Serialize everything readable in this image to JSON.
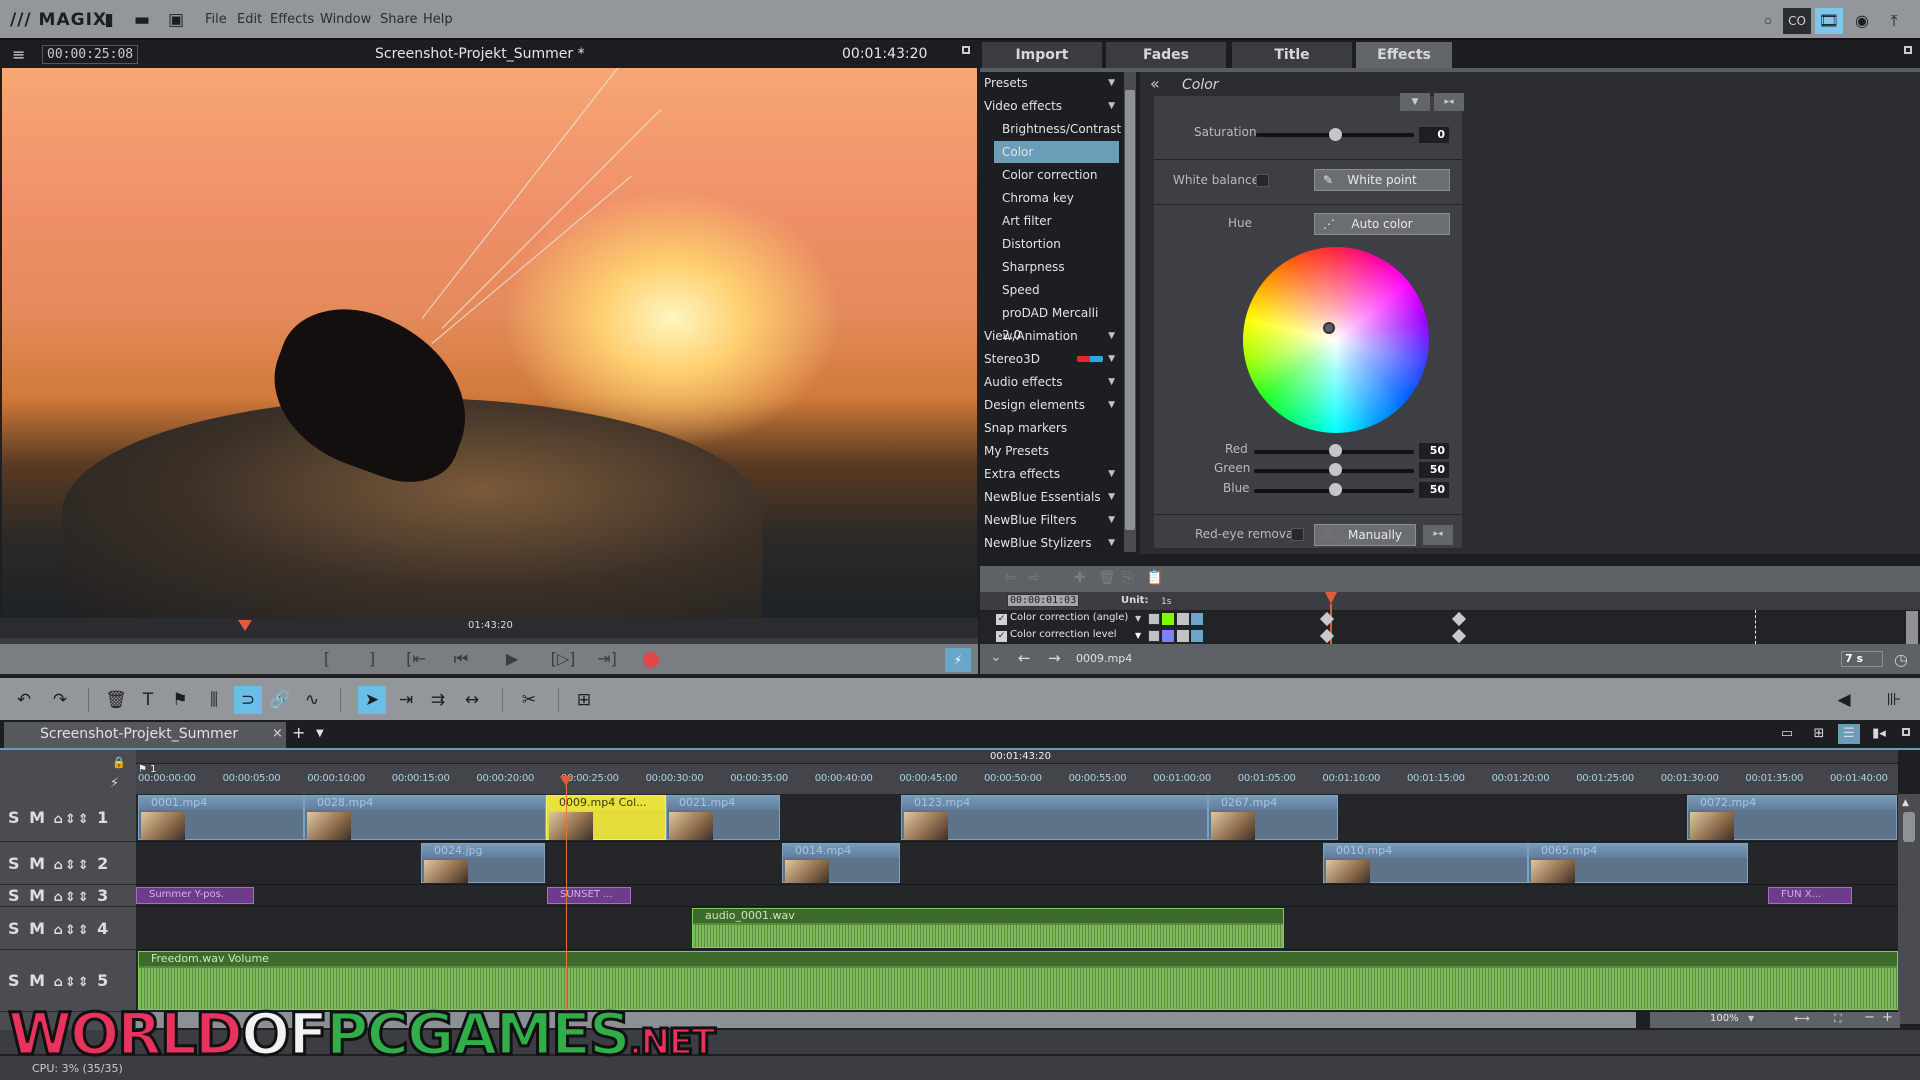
{
  "app": {
    "logo": "/// MAGIX",
    "menu": [
      "File",
      "Edit",
      "Effects",
      "Window",
      "Share",
      "Help"
    ],
    "file_icons": [
      "new-file-icon",
      "open-folder-icon",
      "save-icon"
    ],
    "right_icons": [
      "dot-icon",
      "cloud-icon",
      "movie-edit-icon",
      "disc-icon",
      "upload-icon"
    ]
  },
  "preview": {
    "timecode_current": "00:00:25:08",
    "project_title": "Screenshot-Projekt_Summer *",
    "timecode_total": "00:01:43:20",
    "scrub_time": "01:43:20",
    "transport": [
      "[",
      "]",
      "[⇤",
      "⏮",
      "▶",
      "[▷]",
      "⇥]"
    ]
  },
  "panel": {
    "tabs": [
      "Import",
      "Fades",
      "Title",
      "Effects"
    ],
    "active_tab": "Effects",
    "effects_list": [
      {
        "label": "Presets",
        "sub": false,
        "arrow": true
      },
      {
        "label": "Video effects",
        "sub": false,
        "arrow": true
      },
      {
        "label": "Brightness/Contrast",
        "sub": true
      },
      {
        "label": "Color",
        "sub": true,
        "selected": true
      },
      {
        "label": "Color correction",
        "sub": true
      },
      {
        "label": "Chroma key",
        "sub": true
      },
      {
        "label": "Art filter",
        "sub": true
      },
      {
        "label": "Distortion",
        "sub": true
      },
      {
        "label": "Sharpness",
        "sub": true
      },
      {
        "label": "Speed",
        "sub": true
      },
      {
        "label": "proDAD Mercalli 2.0",
        "sub": true
      },
      {
        "label": "View/Animation",
        "sub": false,
        "arrow": true
      },
      {
        "label": "Stereo3D",
        "sub": false,
        "arrow": true
      },
      {
        "label": "Audio effects",
        "sub": false,
        "arrow": true
      },
      {
        "label": "Design elements",
        "sub": false,
        "arrow": true
      },
      {
        "label": "Snap markers",
        "sub": false
      },
      {
        "label": "My Presets",
        "sub": false
      },
      {
        "label": "Extra effects",
        "sub": false,
        "arrow": true
      },
      {
        "label": "NewBlue Essentials",
        "sub": false,
        "arrow": true
      },
      {
        "label": "NewBlue Filters",
        "sub": false,
        "arrow": true
      },
      {
        "label": "NewBlue Stylizers",
        "sub": false,
        "arrow": true
      }
    ],
    "color": {
      "title": "Color",
      "saturation_label": "Saturation",
      "saturation_value": "0",
      "saturation_pct": 0.5,
      "white_balance_label": "White balance",
      "white_point_label": "White point",
      "hue_label": "Hue",
      "auto_color_label": "Auto color",
      "red_label": "Red",
      "red_value": "50",
      "green_label": "Green",
      "green_value": "50",
      "blue_label": "Blue",
      "blue_value": "50",
      "redeye_label": "Red-eye removal",
      "manually_label": "Manually"
    },
    "keyframes": {
      "timecode": "00:00:01:03",
      "unit_label": "Unit:",
      "unit_value": "1s",
      "rows": [
        {
          "label": "Color correction (angle)",
          "color": "#7cfc00"
        },
        {
          "label": "Color correction level",
          "color": "#8080ff"
        }
      ],
      "clip_name": "0009.mp4",
      "duration": "7 s"
    }
  },
  "timeline": {
    "project_tab": "Screenshot-Projekt_Summer",
    "ruler_center": "00:01:43:20",
    "marker": "1",
    "ticks": [
      "00:00:00:00",
      "00:00:05:00",
      "00:00:10:00",
      "00:00:15:00",
      "00:00:20:00",
      "00:00:25:00",
      "00:00:30:00",
      "00:00:35:00",
      "00:00:40:00",
      "00:00:45:00",
      "00:00:50:00",
      "00:00:55:00",
      "00:01:00:00",
      "00:01:05:00",
      "00:01:10:00",
      "00:01:15:00",
      "00:01:20:00",
      "00:01:25:00",
      "00:01:30:00",
      "00:01:35:00",
      "00:01:40:00"
    ],
    "tracks": [
      {
        "num": "1",
        "clips": [
          {
            "name": "0001.mp4"
          },
          {
            "name": "0028.mp4"
          },
          {
            "name": "0009.mp4   Col..."
          },
          {
            "name": "0021.mp4"
          },
          {
            "name": "0123.mp4"
          },
          {
            "name": "0267.mp4"
          },
          {
            "name": "0072.mp4"
          }
        ]
      },
      {
        "num": "2",
        "clips": [
          {
            "name": "0024.jpg"
          },
          {
            "name": "0014.mp4"
          },
          {
            "name": "0010.mp4"
          },
          {
            "name": "0065.mp4"
          }
        ]
      },
      {
        "num": "3",
        "clips": [
          {
            "name": "Summer   Y-pos."
          },
          {
            "name": "SUNSET ..."
          },
          {
            "name": "FUN   X..."
          }
        ]
      },
      {
        "num": "4",
        "clips": [
          {
            "name": "audio_0001.wav"
          }
        ]
      },
      {
        "num": "5",
        "clips": [
          {
            "name": "Freedom.wav   Volume"
          }
        ]
      }
    ],
    "track_buttons": "S M",
    "zoom": "100%"
  },
  "status": {
    "cpu": "CPU: 3% (35/35)"
  },
  "watermark": {
    "p1": "WORLD",
    "p2": "OF",
    "p3": "PCGAMES",
    "p4": ".NET"
  }
}
